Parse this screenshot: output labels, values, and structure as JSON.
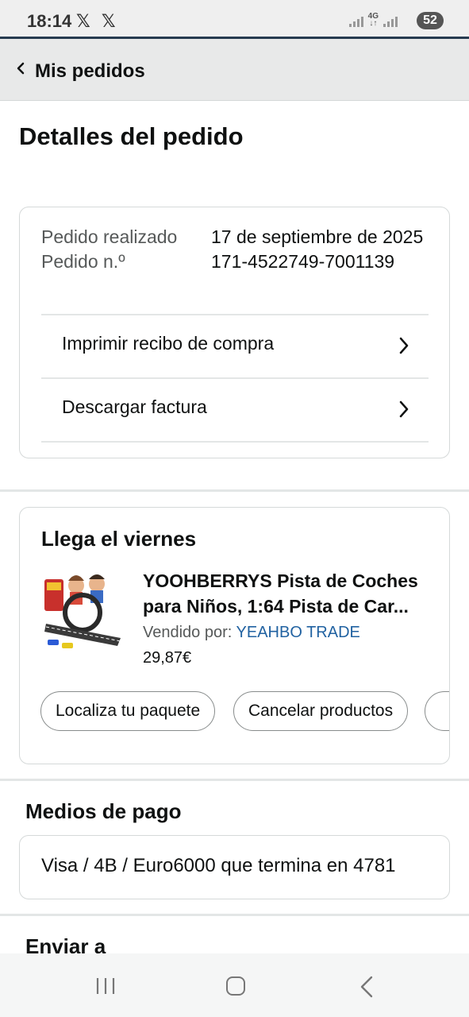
{
  "status_bar": {
    "time": "18:14",
    "notifications": "𝕏 𝕏",
    "network": "4G",
    "battery": "52"
  },
  "header": {
    "back_label": "Mis pedidos"
  },
  "page": {
    "title": "Detalles del pedido"
  },
  "order": {
    "placed_label": "Pedido realizado",
    "number_label": "Pedido n.º",
    "placed_value": "17 de septiembre de 2025",
    "number_value": "171-4522749-7001139",
    "print_receipt": "Imprimir recibo de compra",
    "download_invoice": "Descargar factura"
  },
  "shipment": {
    "title": "Llega el viernes",
    "product_line1": "YOOHBERRYS Pista de Coches",
    "product_line2": "para Niños, 1:64 Pista de Car...",
    "sold_by_label": "Vendido por:",
    "seller": "YEAHBO TRADE",
    "price": "29,87€",
    "actions": [
      "Localiza tu paquete",
      "Cancelar productos"
    ]
  },
  "payment": {
    "title": "Medios de pago",
    "method": "Visa / 4B / Euro6000  que termina en 4781"
  },
  "shipping": {
    "title": "Enviar a"
  },
  "colors": {
    "seller_link": "#2162a1",
    "header_bg": "#e8e9e9",
    "status_line": "#263b50"
  },
  "icons": [
    "back-chevron-icon",
    "chevron-right-icon",
    "recents-icon",
    "home-icon",
    "back-icon"
  ]
}
